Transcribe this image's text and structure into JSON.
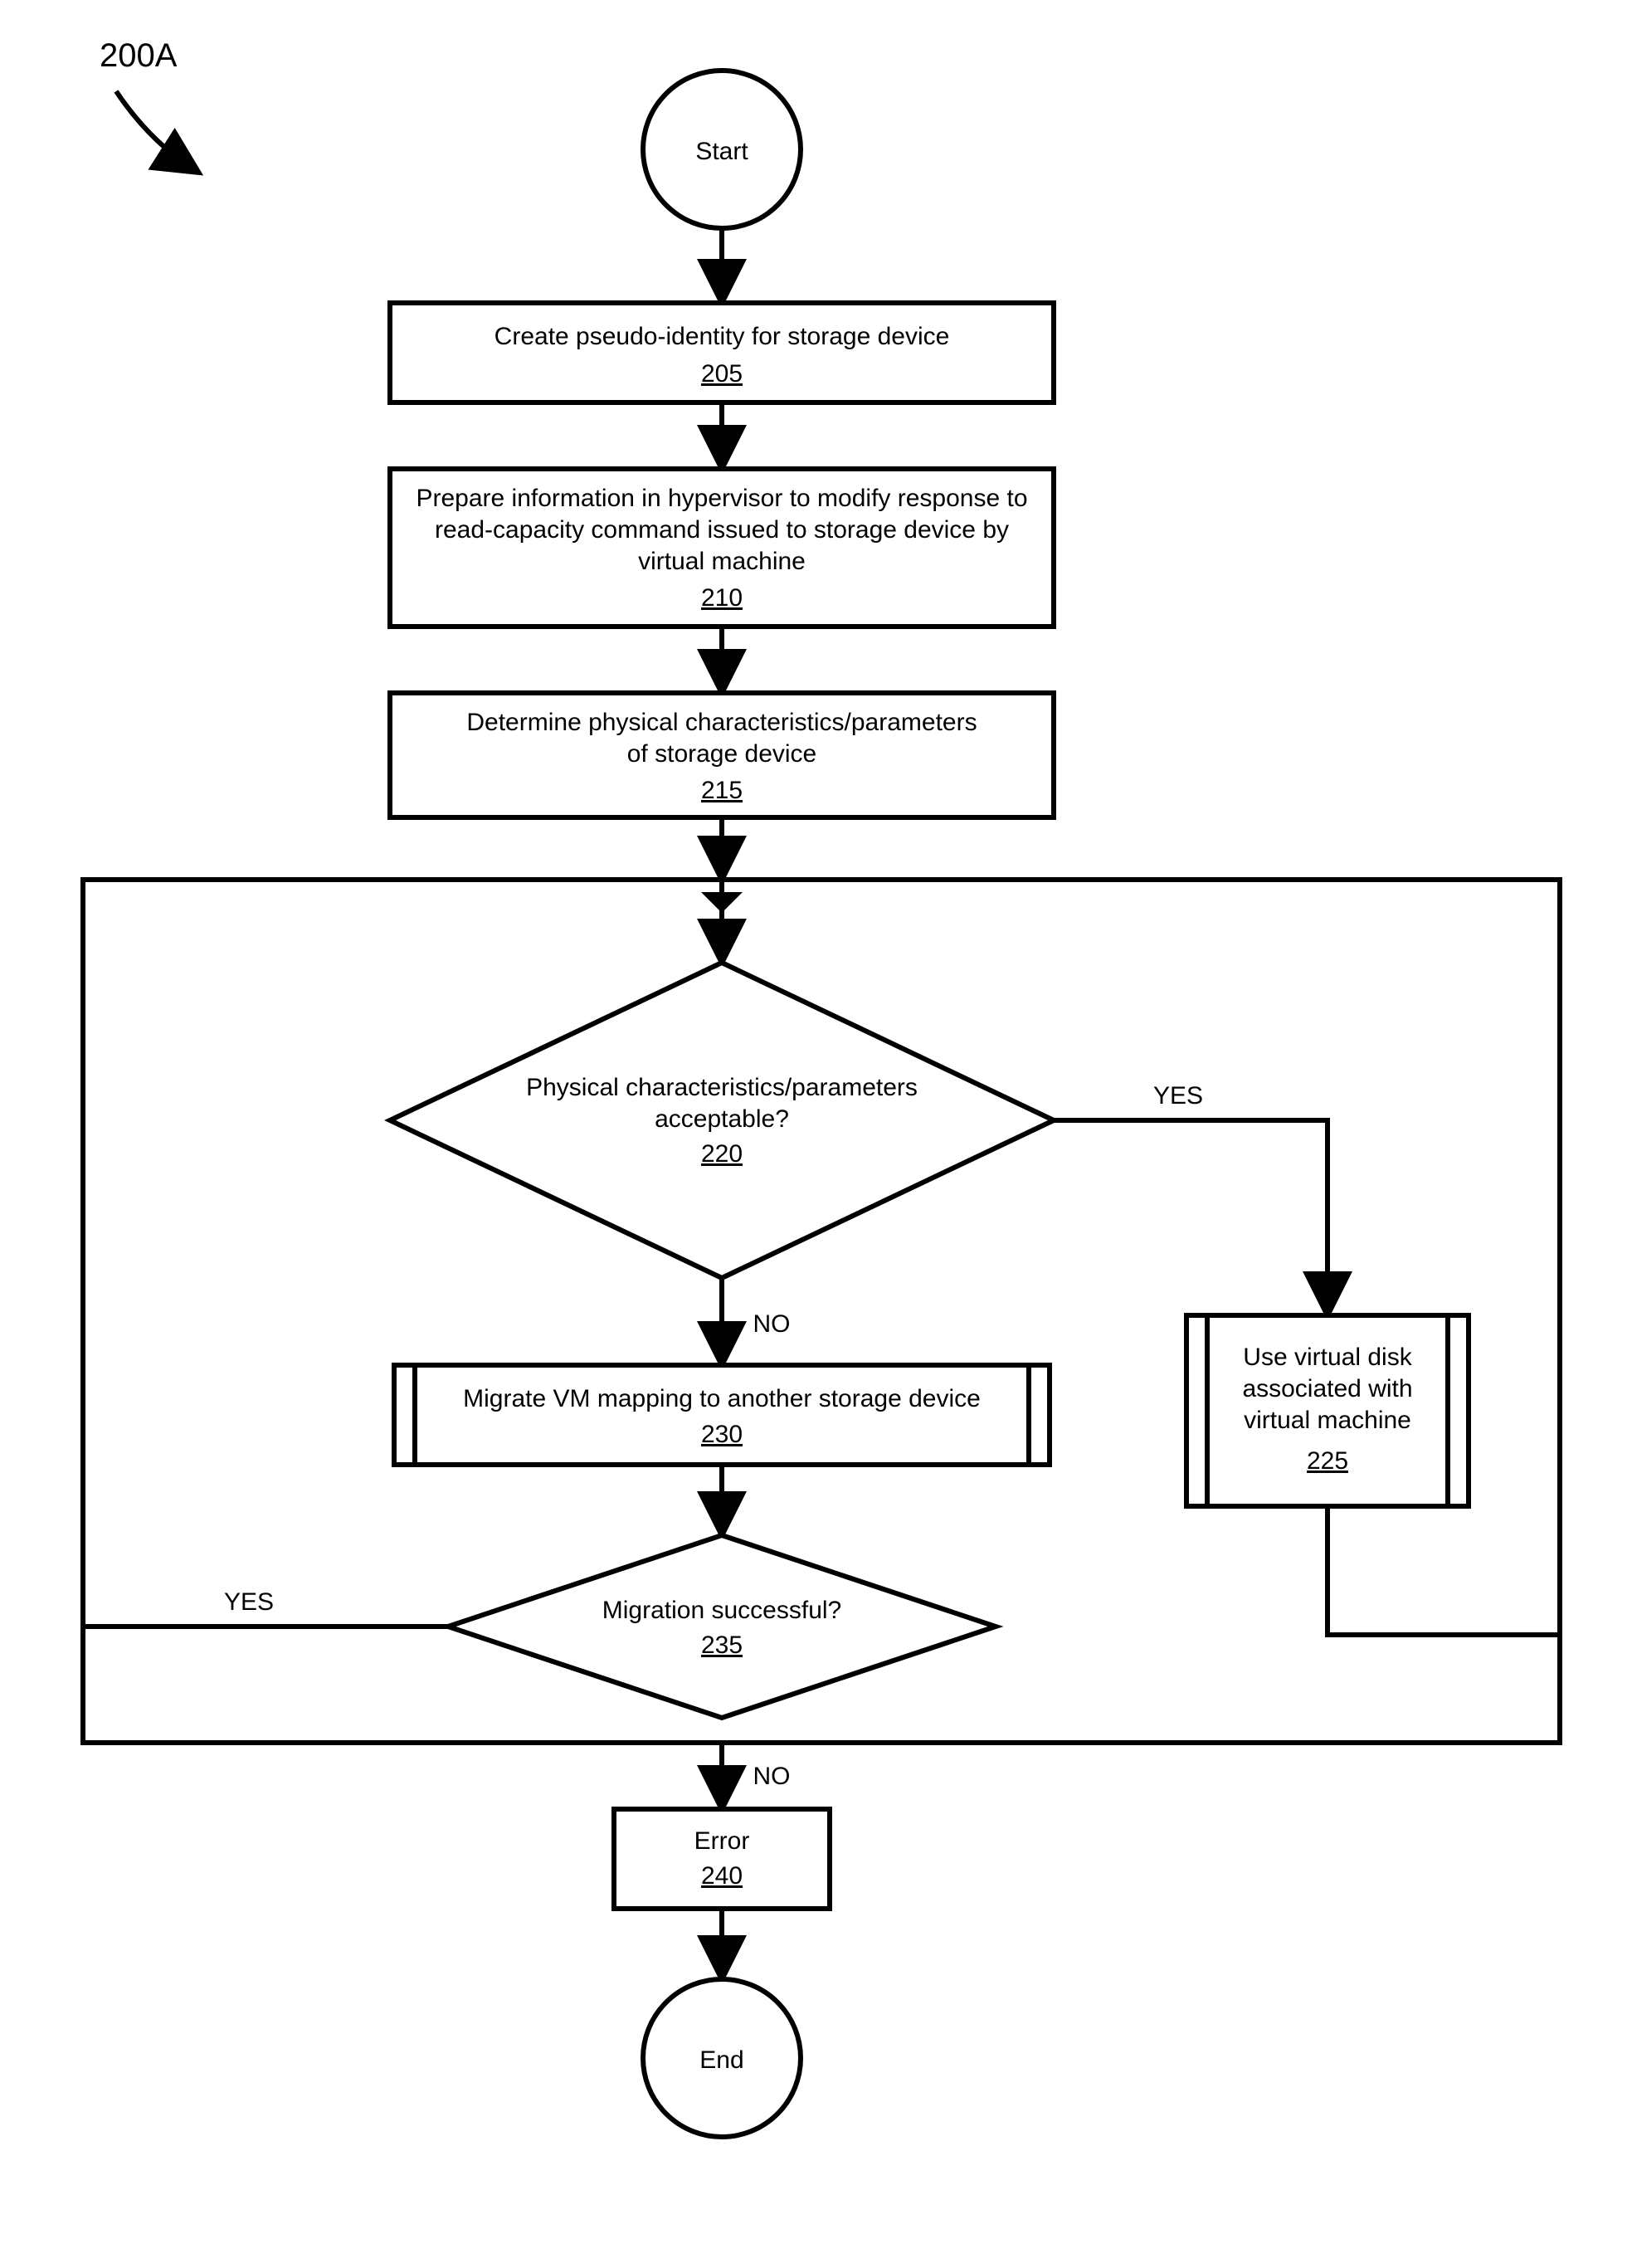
{
  "figure_label": "200A",
  "start": "Start",
  "end": "End",
  "yes": "YES",
  "no": "NO",
  "step205": {
    "text": "Create pseudo-identity for storage device",
    "ref": "205"
  },
  "step210": {
    "l1": "Prepare information in hypervisor to modify response to",
    "l2": "read-capacity command issued to storage device by",
    "l3": "virtual machine",
    "ref": "210"
  },
  "step215": {
    "l1": "Determine physical characteristics/parameters",
    "l2": "of storage device",
    "ref": "215"
  },
  "dec220": {
    "l1": "Physical characteristics/parameters",
    "l2": "acceptable?",
    "ref": "220"
  },
  "step225": {
    "l1": "Use virtual disk",
    "l2": "associated with",
    "l3": "virtual machine",
    "ref": "225"
  },
  "step230": {
    "text": "Migrate VM mapping to another storage device",
    "ref": "230"
  },
  "dec235": {
    "text": "Migration successful?",
    "ref": "235"
  },
  "step240": {
    "text": "Error",
    "ref": "240"
  }
}
